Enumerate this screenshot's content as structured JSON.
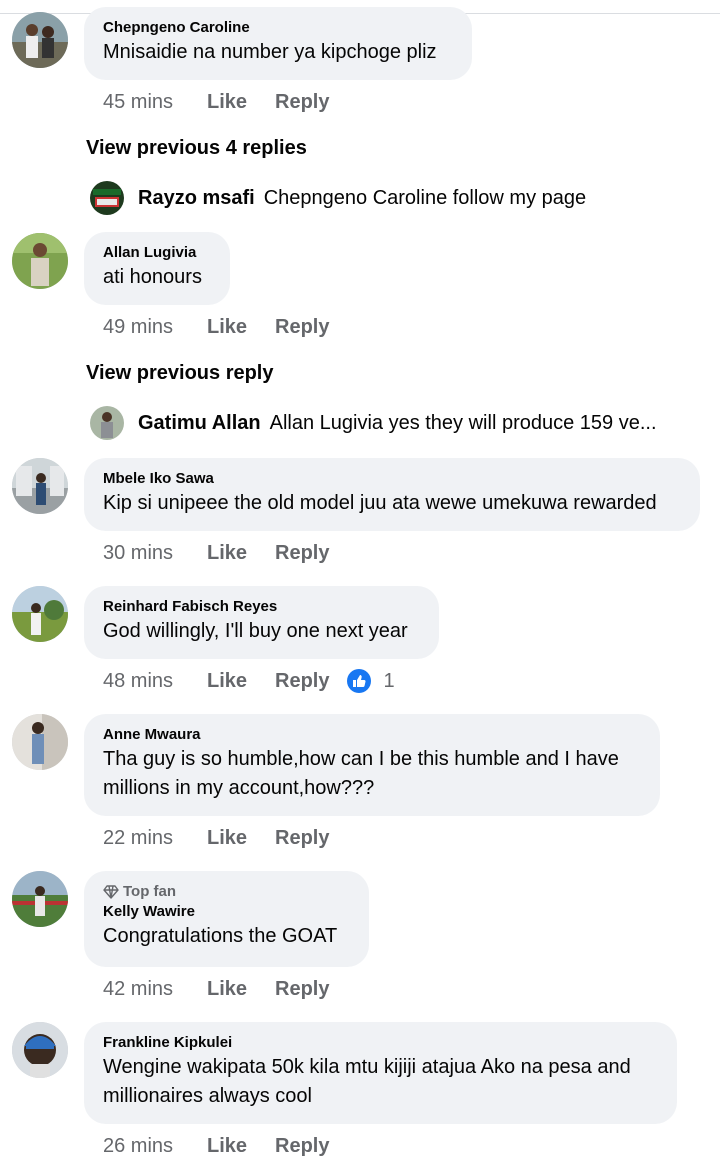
{
  "comments": [
    {
      "author": "Chepngeno Caroline",
      "text": "Mnisaidie na number ya kipchoge pliz",
      "time": "45 mins",
      "like": "Like",
      "reply": "Reply"
    },
    {
      "author": "Allan Lugivia",
      "text": "ati honours",
      "time": "49 mins",
      "like": "Like",
      "reply": "Reply"
    },
    {
      "author": "Mbele Iko Sawa",
      "text": "Kip si unipeee the old model juu ata wewe umekuwa rewarded",
      "time": "30 mins",
      "like": "Like",
      "reply": "Reply"
    },
    {
      "author": "Reinhard Fabisch Reyes",
      "text": "God willingly, I'll buy one next year",
      "time": "48 mins",
      "like": "Like",
      "reply": "Reply",
      "reaction_count": "1",
      "reaction_icon": "thumbs-up-icon",
      "reaction_color": "#1877f2"
    },
    {
      "author": "Anne Mwaura",
      "text_line1": "Tha guy is so humble,how can I be this humble and I have",
      "text_line2": "millions in my account,how???",
      "time": "22 mins",
      "like": "Like",
      "reply": "Reply"
    },
    {
      "badge": "Top fan",
      "badge_icon": "diamond-icon",
      "author": "Kelly Wawire",
      "text": "Congratulations the GOAT",
      "time": "42 mins",
      "like": "Like",
      "reply": "Reply"
    },
    {
      "author": "Frankline Kipkulei",
      "text_line1": "Wengine wakipata 50k kila mtu kijiji atajua Ako na pesa and",
      "text_line2": "millionaires always cool",
      "time": "26 mins",
      "like": "Like",
      "reply": "Reply"
    }
  ],
  "thread1": {
    "view_previous": "View previous 4 replies",
    "reply_author": "Rayzo msafi",
    "reply_text": "Chepngeno Caroline follow my page"
  },
  "thread2": {
    "view_previous": "View previous reply",
    "reply_author": "Gatimu Allan",
    "reply_text": "Allan Lugivia yes they will  produce 159 ve..."
  },
  "colors": {
    "bubble": "#f0f2f5",
    "meta": "#65676b",
    "accent": "#1877f2"
  }
}
